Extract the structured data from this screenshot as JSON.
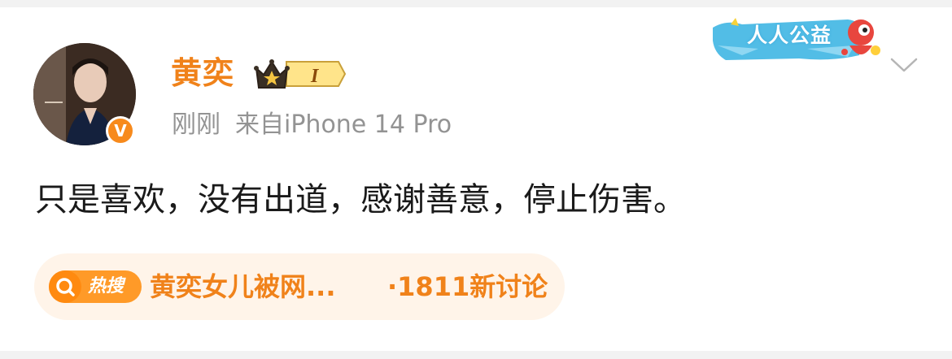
{
  "post": {
    "author": {
      "name": "黄奕",
      "vip_level": "I",
      "verified_badge": "V"
    },
    "meta": {
      "time": "刚刚",
      "source": "来自iPhone 14 Pro"
    },
    "content": "只是喜欢，没有出道，感谢善意，停止伤害。",
    "charity_banner": "人人公益",
    "hot_search": {
      "tag": "热搜",
      "topic": "黄奕女儿被网...",
      "discussion": "·1811新讨论"
    }
  },
  "icons": {
    "avatar_badge": "verified-v-icon",
    "vip": "crown-icon",
    "more": "chevron-down-icon",
    "hot": "search-icon"
  },
  "colors": {
    "accent_orange": "#f0821a",
    "meta_gray": "#939393",
    "text": "#1a1a1a",
    "pill_bg": "#fff4e9",
    "hot_tag": "#ff9a28"
  }
}
